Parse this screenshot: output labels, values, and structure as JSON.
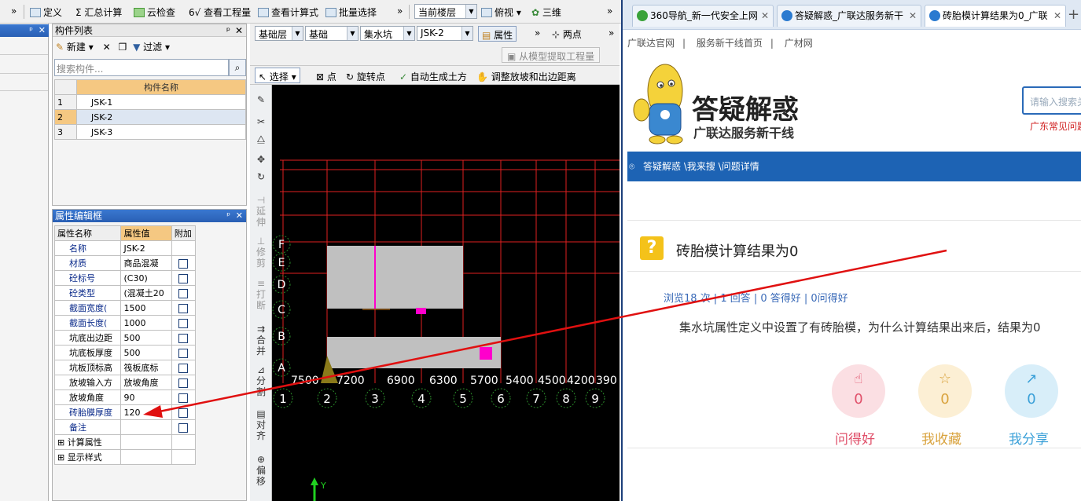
{
  "toolbar": {
    "items": [
      "定义",
      "汇总计算",
      "云检查",
      "查看工程量",
      "查看计算式",
      "批量选择"
    ],
    "floor_combo": "当前楼层",
    "view_label": "俯视",
    "three_d_label": "三维"
  },
  "component_list": {
    "title": "构件列表",
    "new_label": "新建",
    "filter_label": "过滤",
    "search_placeholder": "搜索构件...",
    "column_header": "构件名称",
    "rows": [
      {
        "index": "1",
        "name": "JSK-1"
      },
      {
        "index": "2",
        "name": "JSK-2"
      },
      {
        "index": "3",
        "name": "JSK-3"
      }
    ]
  },
  "property_panel": {
    "title": "属性编辑框",
    "headers": [
      "属性名称",
      "属性值",
      "附加"
    ],
    "rows": [
      {
        "name": "名称",
        "value": "JSK-2",
        "blue": true,
        "checkbox": false
      },
      {
        "name": "材质",
        "value": "商品混凝",
        "blue": true,
        "checkbox": true
      },
      {
        "name": "砼标号",
        "value": "(C30)",
        "blue": true,
        "checkbox": true
      },
      {
        "name": "砼类型",
        "value": "(混凝土20",
        "blue": true,
        "checkbox": true
      },
      {
        "name": "截面宽度(",
        "value": "1500",
        "blue": true,
        "checkbox": true
      },
      {
        "name": "截面长度(",
        "value": "1000",
        "blue": true,
        "checkbox": true
      },
      {
        "name": "坑底出边距",
        "value": "500",
        "blue": false,
        "checkbox": true
      },
      {
        "name": "坑底板厚度",
        "value": "500",
        "blue": false,
        "checkbox": true
      },
      {
        "name": "坑板顶标高",
        "value": "筏板底标",
        "blue": false,
        "checkbox": true
      },
      {
        "name": "放坡输入方",
        "value": "放坡角度",
        "blue": false,
        "checkbox": true
      },
      {
        "name": "放坡角度",
        "value": "90",
        "blue": false,
        "checkbox": true
      },
      {
        "name": "砖胎膜厚度",
        "value": "120",
        "blue": true,
        "checkbox": true
      },
      {
        "name": "备注",
        "value": "",
        "blue": true,
        "checkbox": true
      }
    ],
    "groups": [
      "计算属性",
      "显示样式"
    ]
  },
  "layer_bar": {
    "layer": "基础层",
    "category": "基础",
    "type": "集水坑",
    "component": "JSK-2",
    "attr_label": "属性",
    "two_point_label": "两点",
    "extract_label": "从模型提取工程量"
  },
  "draw_bar": {
    "select_label": "选择",
    "point_label": "点",
    "rotate_label": "旋转点",
    "auto_earth_label": "自动生成土方",
    "adjust_label": "调整放坡和出边距离"
  },
  "vertical_tools": [
    "延伸",
    "修剪",
    "打断",
    "合并",
    "分割",
    "对齐",
    "偏移"
  ],
  "cad": {
    "row_labels": [
      "F",
      "E",
      "D",
      "C",
      "B",
      "A"
    ],
    "col_labels": [
      "1",
      "2",
      "3",
      "4",
      "5",
      "6",
      "7",
      "8",
      "9"
    ],
    "dims": [
      "7500",
      "7200",
      "6900",
      "6300",
      "5700",
      "5400",
      "4500",
      "4200",
      "390"
    ],
    "y_axis": "Y"
  },
  "browser": {
    "tabs": [
      {
        "label": "360导航_新一代安全上网",
        "active": false
      },
      {
        "label": "答疑解惑_广联达服务新干",
        "active": false
      },
      {
        "label": "砖胎模计算结果为0_广联",
        "active": true
      }
    ],
    "links": [
      "广联达官网",
      "服务新干线首页",
      "广材网"
    ],
    "logo_title": "答疑解惑",
    "logo_sub": "广联达服务新干线",
    "search_placeholder": "请输入搜索关",
    "search_hint": "广东常见问题",
    "breadcrumb": "答疑解惑 \\我来搜 \\问题详情",
    "question_title": "砖胎模计算结果为0",
    "stats": "浏览18 次 | 1 回答 | 0 答得好 | 0问得好",
    "question_body": "集水坑属性定义中设置了有砖胎模，为什么计算结果出来后，结果为0",
    "actions": [
      {
        "label": "问得好",
        "count": "0",
        "color": "#e0506a",
        "bg": "#fbdfe3"
      },
      {
        "label": "我收藏",
        "count": "0",
        "color": "#d9a33e",
        "bg": "#fcefd4"
      },
      {
        "label": "我分享",
        "count": "0",
        "color": "#3aa0d8",
        "bg": "#d8eef9"
      }
    ]
  },
  "colors": {
    "panel_blue": "#2a5fb4",
    "red_arrow": "#e01010",
    "grid_red": "#e02020",
    "magenta": "#ff00cc",
    "canvas_bg": "#000000",
    "brand_blue": "#1d63b4"
  }
}
